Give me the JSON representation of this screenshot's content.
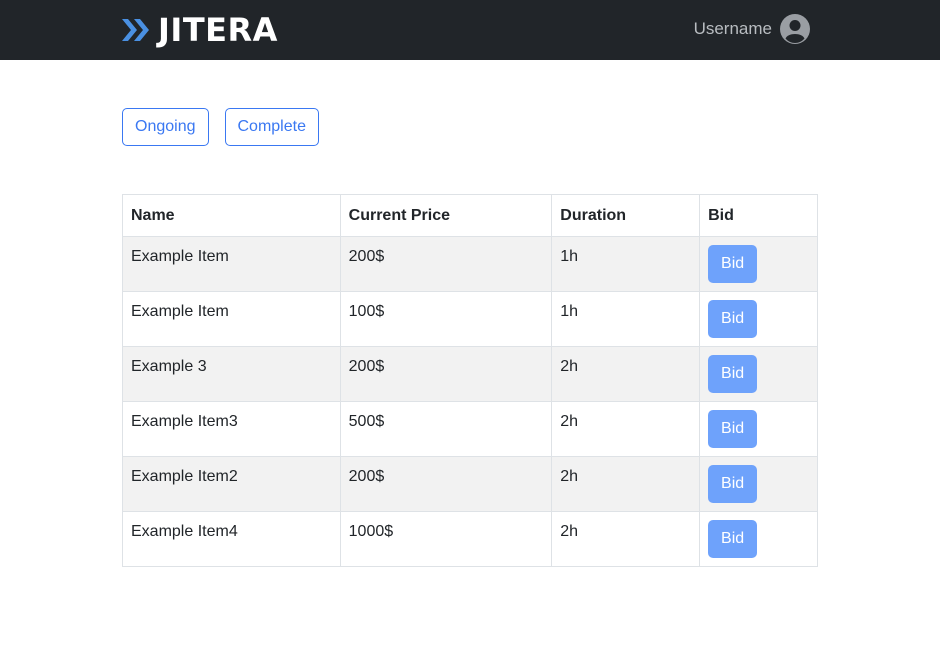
{
  "header": {
    "brand": "JITERA",
    "username": "Username",
    "brand_icon": "double-chevron-icon",
    "avatar_icon": "user-circle-icon",
    "colors": {
      "bar": "#212529",
      "brand_mark": "#4a90e2"
    }
  },
  "tabs": [
    {
      "label": "Ongoing"
    },
    {
      "label": "Complete"
    }
  ],
  "table": {
    "headers": [
      "Name",
      "Current Price",
      "Duration",
      "Bid"
    ],
    "rows": [
      {
        "name": "Example Item",
        "price": "200$",
        "duration": "1h",
        "action": "Bid"
      },
      {
        "name": "Example Item",
        "price": "100$",
        "duration": "1h",
        "action": "Bid"
      },
      {
        "name": "Example 3",
        "price": "200$",
        "duration": "2h",
        "action": "Bid"
      },
      {
        "name": "Example Item3",
        "price": "500$",
        "duration": "2h",
        "action": "Bid"
      },
      {
        "name": "Example Item2",
        "price": "200$",
        "duration": "2h",
        "action": "Bid"
      },
      {
        "name": "Example Item4",
        "price": "1000$",
        "duration": "2h",
        "action": "Bid"
      }
    ]
  }
}
